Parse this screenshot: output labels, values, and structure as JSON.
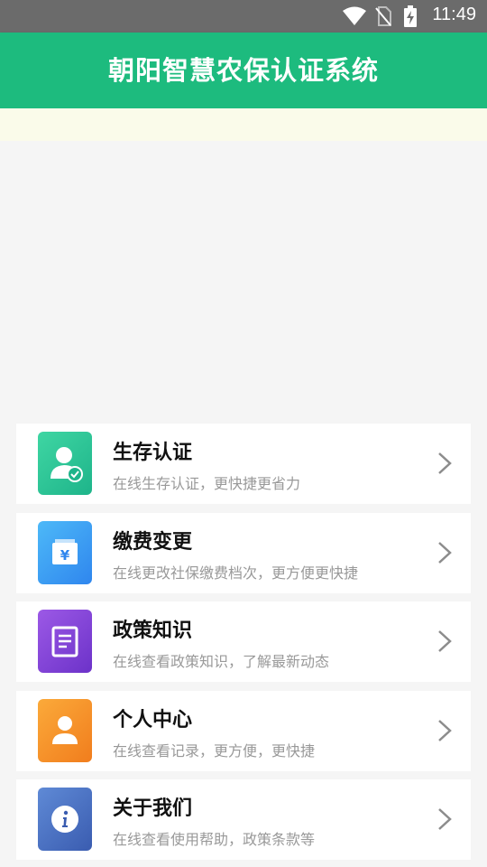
{
  "status_bar": {
    "time": "11:49"
  },
  "app_bar": {
    "title": "朝阳智慧农保认证系统"
  },
  "menu": [
    {
      "title": "生存认证",
      "desc": "在线生存认证，更快捷更省力",
      "icon": "person-check-icon",
      "color": "#22c08f"
    },
    {
      "title": "缴费变更",
      "desc": "在线更改社保缴费档次，更方便更快捷",
      "icon": "yuan-wallet-icon",
      "color": "#3a9ef2"
    },
    {
      "title": "政策知识",
      "desc": "在线查看政策知识，了解最新动态",
      "icon": "document-icon",
      "color": "#8444d8"
    },
    {
      "title": "个人中心",
      "desc": "在线查看记录，更方便，更快捷",
      "icon": "person-icon",
      "color": "#f59128"
    },
    {
      "title": "关于我们",
      "desc": "在线查看使用帮助，政策条款等",
      "icon": "info-icon",
      "color": "#4a72c4"
    }
  ]
}
